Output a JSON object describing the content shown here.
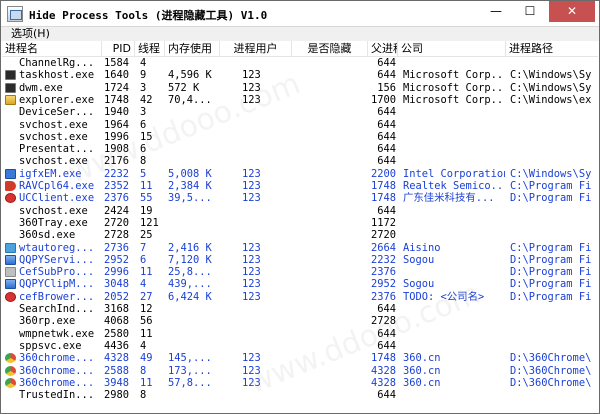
{
  "window": {
    "title": "Hide Process Tools (进程隐藏工具) V1.0",
    "controls": {
      "minimize": "—",
      "maximize": "☐",
      "close": "✕"
    }
  },
  "menu": {
    "options": "选项(H)"
  },
  "columns": {
    "name": "进程名",
    "pid": "PID",
    "threads": "线程",
    "memory": "内存使用",
    "user": "进程用户",
    "hidden": "是否隐藏",
    "parent_pid": "父进程",
    "company": "公司",
    "path": "进程路径"
  },
  "processes": [
    {
      "icon": "none",
      "name": "ChannelRg...",
      "pid": "1584",
      "threads": "4",
      "memory": "",
      "user": "",
      "ppid": "644",
      "company": "",
      "path": "",
      "blue": false
    },
    {
      "icon": "console-icon",
      "name": "taskhost.exe",
      "pid": "1640",
      "threads": "9",
      "memory": "4,596 K",
      "user": "123",
      "ppid": "644",
      "company": "Microsoft Corp...",
      "path": "C:\\Windows\\Sy",
      "blue": false
    },
    {
      "icon": "console-icon",
      "name": "dwm.exe",
      "pid": "1724",
      "threads": "3",
      "memory": "572 K",
      "user": "123",
      "ppid": "156",
      "company": "Microsoft Corp...",
      "path": "C:\\Windows\\Sy",
      "blue": false
    },
    {
      "icon": "explorer-icon",
      "name": "explorer.exe",
      "pid": "1748",
      "threads": "42",
      "memory": "70,4...",
      "user": "123",
      "ppid": "1700",
      "company": "Microsoft Corp...",
      "path": "C:\\Windows\\ex",
      "blue": false
    },
    {
      "icon": "none",
      "name": "DeviceSer...",
      "pid": "1940",
      "threads": "3",
      "memory": "",
      "user": "",
      "ppid": "644",
      "company": "",
      "path": "",
      "blue": false
    },
    {
      "icon": "none",
      "name": "svchost.exe",
      "pid": "1964",
      "threads": "6",
      "memory": "",
      "user": "",
      "ppid": "644",
      "company": "",
      "path": "",
      "blue": false
    },
    {
      "icon": "none",
      "name": "svchost.exe",
      "pid": "1996",
      "threads": "15",
      "memory": "",
      "user": "",
      "ppid": "644",
      "company": "",
      "path": "",
      "blue": false
    },
    {
      "icon": "none",
      "name": "Presentat...",
      "pid": "1908",
      "threads": "6",
      "memory": "",
      "user": "",
      "ppid": "644",
      "company": "",
      "path": "",
      "blue": false
    },
    {
      "icon": "none",
      "name": "svchost.exe",
      "pid": "2176",
      "threads": "8",
      "memory": "",
      "user": "",
      "ppid": "644",
      "company": "",
      "path": "",
      "blue": false
    },
    {
      "icon": "blue-app-icon",
      "name": "igfxEM.exe",
      "pid": "2232",
      "threads": "5",
      "memory": "5,008 K",
      "user": "123",
      "ppid": "2200",
      "company": "Intel Corporation",
      "path": "C:\\Windows\\Sy",
      "blue": true
    },
    {
      "icon": "speaker-icon",
      "name": "RAVCpl64.exe",
      "pid": "2352",
      "threads": "11",
      "memory": "2,384 K",
      "user": "123",
      "ppid": "1748",
      "company": "Realtek Semico...",
      "path": "C:\\Program Fi",
      "blue": true
    },
    {
      "icon": "uc-icon",
      "name": "UCClient.exe",
      "pid": "2376",
      "threads": "55",
      "memory": "39,5...",
      "user": "123",
      "ppid": "1748",
      "company": "广东佳米科技有...",
      "path": "D:\\Program Fi",
      "blue": true
    },
    {
      "icon": "none",
      "name": "svchost.exe",
      "pid": "2424",
      "threads": "19",
      "memory": "",
      "user": "",
      "ppid": "644",
      "company": "",
      "path": "",
      "blue": false
    },
    {
      "icon": "none",
      "name": "360Tray.exe",
      "pid": "2720",
      "threads": "121",
      "memory": "",
      "user": "",
      "ppid": "1172",
      "company": "",
      "path": "",
      "blue": false
    },
    {
      "icon": "none",
      "name": "360sd.exe",
      "pid": "2728",
      "threads": "25",
      "memory": "",
      "user": "",
      "ppid": "2720",
      "company": "",
      "path": "",
      "blue": false
    },
    {
      "icon": "tw-icon",
      "name": "wtautoreg...",
      "pid": "2736",
      "threads": "7",
      "memory": "2,416 K",
      "user": "123",
      "ppid": "2664",
      "company": "Aisino",
      "path": "C:\\Program Fi",
      "blue": true
    },
    {
      "icon": "qq-icon",
      "name": "QQPYServi...",
      "pid": "2952",
      "threads": "6",
      "memory": "7,120 K",
      "user": "123",
      "ppid": "2232",
      "company": "Sogou",
      "path": "D:\\Program Fi",
      "blue": true
    },
    {
      "icon": "gray-app-icon",
      "name": "CefSubPro...",
      "pid": "2996",
      "threads": "11",
      "memory": "25,8...",
      "user": "123",
      "ppid": "2376",
      "company": "",
      "path": "D:\\Program Fi",
      "blue": true
    },
    {
      "icon": "qq-icon",
      "name": "QQPYClipM...",
      "pid": "3048",
      "threads": "4",
      "memory": "439,...",
      "user": "123",
      "ppid": "2952",
      "company": "Sogou",
      "path": "D:\\Program Fi",
      "blue": true
    },
    {
      "icon": "uc-icon",
      "name": "cefBrower...",
      "pid": "2052",
      "threads": "27",
      "memory": "6,424 K",
      "user": "123",
      "ppid": "2376",
      "company": "TODO: <公司名>",
      "path": "D:\\Program Fi",
      "blue": true
    },
    {
      "icon": "none",
      "name": "SearchInd...",
      "pid": "3168",
      "threads": "12",
      "memory": "",
      "user": "",
      "ppid": "644",
      "company": "",
      "path": "",
      "blue": false
    },
    {
      "icon": "none",
      "name": "360rp.exe",
      "pid": "4068",
      "threads": "56",
      "memory": "",
      "user": "",
      "ppid": "2728",
      "company": "",
      "path": "",
      "blue": false
    },
    {
      "icon": "none",
      "name": "wmpnetwk.exe",
      "pid": "2580",
      "threads": "11",
      "memory": "",
      "user": "",
      "ppid": "644",
      "company": "",
      "path": "",
      "blue": false
    },
    {
      "icon": "none",
      "name": "sppsvc.exe",
      "pid": "4436",
      "threads": "4",
      "memory": "",
      "user": "",
      "ppid": "644",
      "company": "",
      "path": "",
      "blue": false
    },
    {
      "icon": "chrome-icon",
      "name": "360chrome...",
      "pid": "4328",
      "threads": "49",
      "memory": "145,...",
      "user": "123",
      "ppid": "1748",
      "company": "360.cn",
      "path": "D:\\360Chrome\\",
      "blue": true
    },
    {
      "icon": "chrome-icon",
      "name": "360chrome...",
      "pid": "2588",
      "threads": "8",
      "memory": "173,...",
      "user": "123",
      "ppid": "4328",
      "company": "360.cn",
      "path": "D:\\360Chrome\\",
      "blue": true
    },
    {
      "icon": "chrome-icon",
      "name": "360chrome...",
      "pid": "3948",
      "threads": "11",
      "memory": "57,8...",
      "user": "123",
      "ppid": "4328",
      "company": "360.cn",
      "path": "D:\\360Chrome\\",
      "blue": true
    },
    {
      "icon": "none",
      "name": "TrustedIn...",
      "pid": "2980",
      "threads": "8",
      "memory": "",
      "user": "",
      "ppid": "644",
      "company": "",
      "path": "",
      "blue": false
    }
  ],
  "colors": {
    "hidden_row_text": "#1a3fd6",
    "normal_text": "#000000",
    "close_button": "#c75050"
  }
}
